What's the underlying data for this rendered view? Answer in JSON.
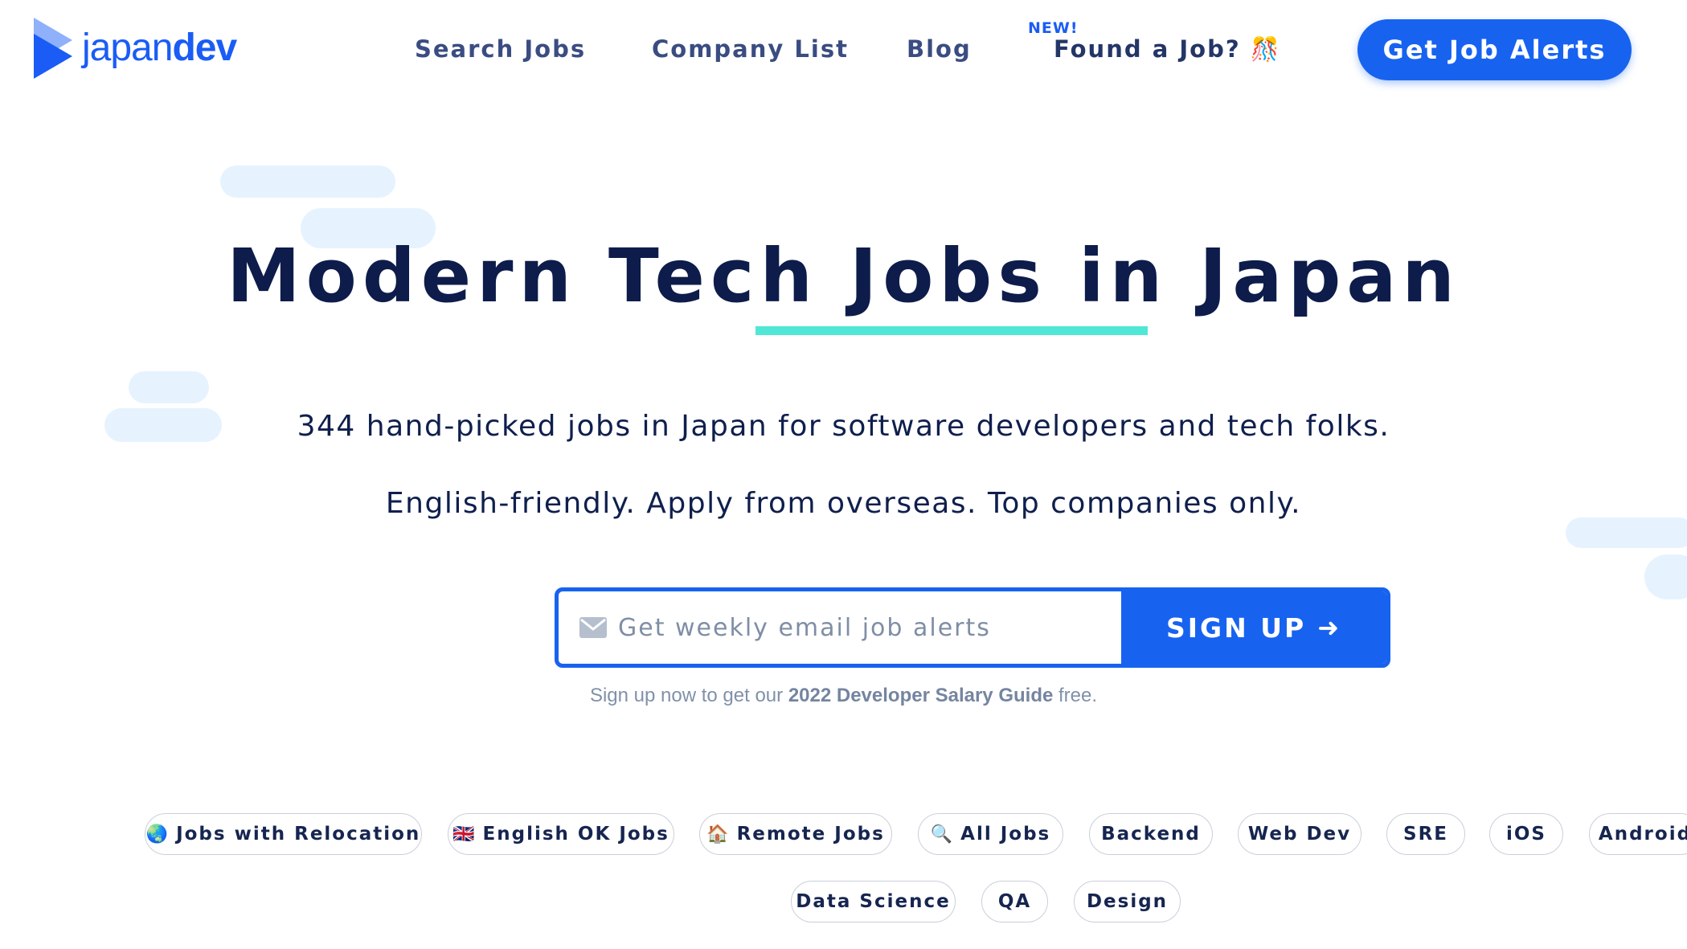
{
  "logo": {
    "text_light": "japan",
    "text_bold": "dev",
    "brand_color": "#1a5cf5"
  },
  "nav": {
    "search_jobs": "Search Jobs",
    "company_list": "Company List",
    "blog": "Blog",
    "new_badge": "NEW!",
    "found_job": "Found a Job? 🎊",
    "cta": "Get Job Alerts"
  },
  "hero": {
    "title_pre": "Modern ",
    "title_highlight": "Tech Jobs",
    "title_post": " in Japan",
    "subtitle_1": "344 hand-picked jobs in Japan for software developers and tech folks.",
    "subtitle_2": "English-friendly. Apply from overseas. Top companies only.",
    "highlight_color": "#4fe8d6"
  },
  "signup": {
    "placeholder": "Get weekly email job alerts",
    "button_label": "SIGN UP",
    "button_arrow": "➜",
    "note_pre": "Sign up now to get our ",
    "note_bold": "2022 Developer Salary Guide",
    "note_post": " free.",
    "accent_color": "#1763f0"
  },
  "tags": {
    "relocation": {
      "emoji": "🌏",
      "label": "Jobs with Relocation"
    },
    "english": {
      "emoji": "🇬🇧",
      "label": "English OK Jobs"
    },
    "remote": {
      "emoji": "🏠",
      "label": "Remote Jobs"
    },
    "all": {
      "emoji": "🔍",
      "label": "All Jobs"
    },
    "backend": "Backend",
    "webdev": "Web Dev",
    "sre": "SRE",
    "ios": "iOS",
    "android": "Android",
    "datascience": "Data Science",
    "qa": "QA",
    "design": "Design"
  }
}
